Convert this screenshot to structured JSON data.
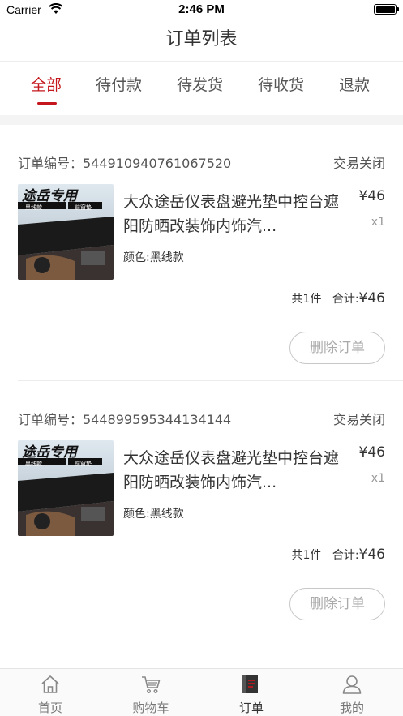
{
  "status_bar": {
    "carrier": "Carrier",
    "time": "2:46 PM"
  },
  "header": {
    "title": "订单列表"
  },
  "tabs": [
    {
      "label": "全部",
      "active": true
    },
    {
      "label": "待付款",
      "active": false
    },
    {
      "label": "待发货",
      "active": false
    },
    {
      "label": "待收货",
      "active": false
    },
    {
      "label": "退款",
      "active": false
    }
  ],
  "orders": [
    {
      "order_no": "订单编号：544910940761067520",
      "status": "交易关闭",
      "thumb_text": "途岳专用",
      "thumb_tag1": "黑线款",
      "thumb_tag2": "前窗垫",
      "product_name": "大众途岳仪表盘避光垫中控台遮阳防晒改装饰内饰汽...",
      "price": "¥46",
      "qty": "x1",
      "spec": "颜色:黑线款",
      "count_text": "共1件",
      "total_label": "合计:",
      "total": "¥46",
      "delete_label": "删除订单"
    },
    {
      "order_no": "订单编号：544899595344134144",
      "status": "交易关闭",
      "thumb_text": "途岳专用",
      "thumb_tag1": "黑线款",
      "thumb_tag2": "前窗垫",
      "product_name": "大众途岳仪表盘避光垫中控台遮阳防晒改装饰内饰汽...",
      "price": "¥46",
      "qty": "x1",
      "spec": "颜色:黑线款",
      "count_text": "共1件",
      "total_label": "合计:",
      "total": "¥46",
      "delete_label": "删除订单"
    }
  ],
  "tabbar": [
    {
      "label": "首页",
      "icon": "home-icon",
      "active": false
    },
    {
      "label": "购物车",
      "icon": "cart-icon",
      "active": false
    },
    {
      "label": "订单",
      "icon": "order-icon",
      "active": true
    },
    {
      "label": "我的",
      "icon": "profile-icon",
      "active": false
    }
  ],
  "colors": {
    "accent": "#c4161c",
    "text": "#333333",
    "muted": "#999999"
  }
}
